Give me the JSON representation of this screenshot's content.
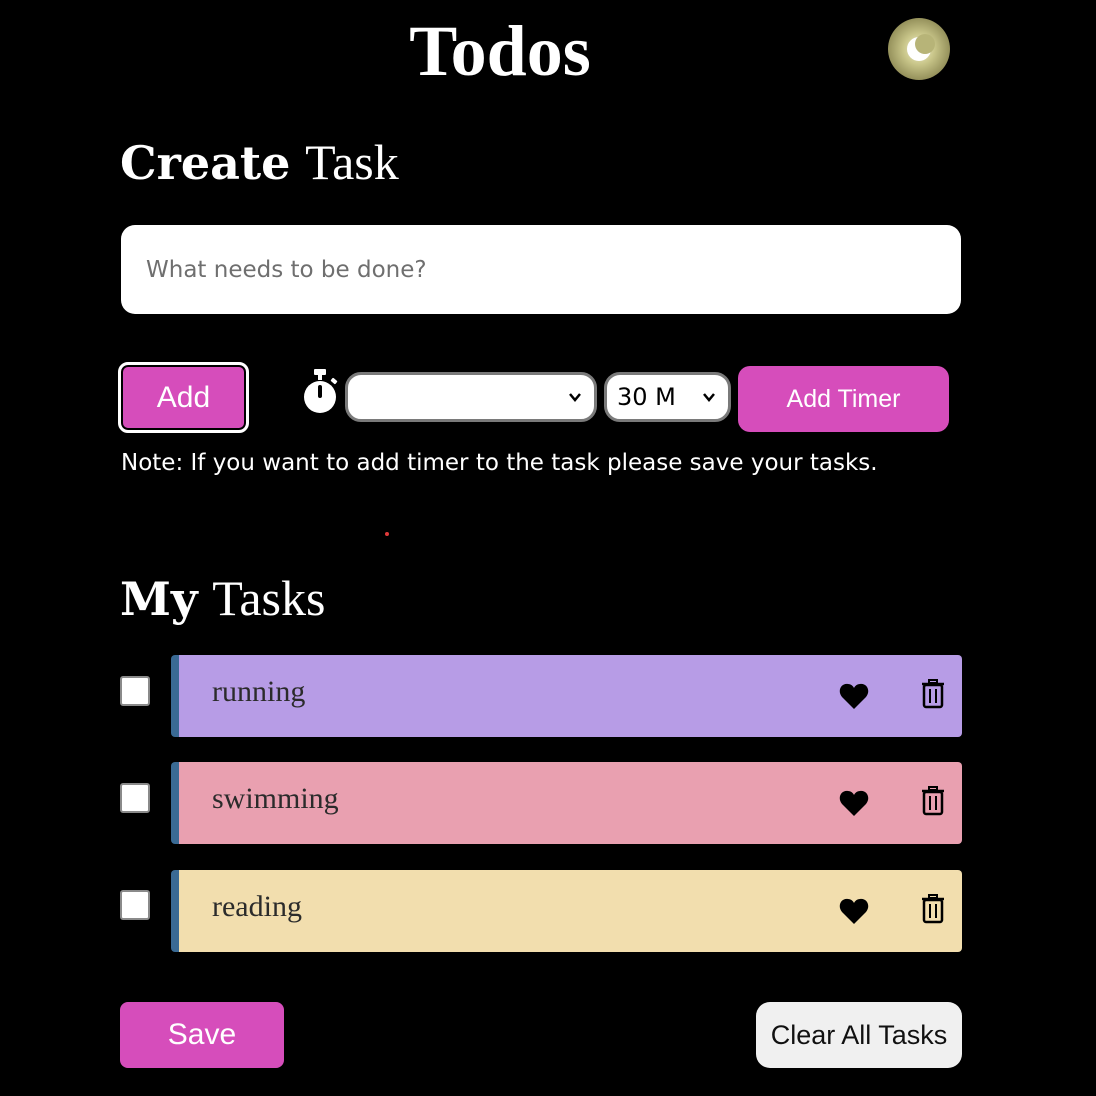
{
  "header": {
    "title": "Todos",
    "theme_toggle_icon": "moon-icon"
  },
  "create_section": {
    "title_bold": "Create",
    "title_light": "Task",
    "input_placeholder": "What needs to be done?",
    "input_value": "",
    "add_label": "Add",
    "timer_icon": "stopwatch-icon",
    "task_select_value": "",
    "duration_select_value": "30 M",
    "add_timer_label": "Add Timer",
    "note": "Note: If you want to add timer to the task please save your tasks."
  },
  "tasks_section": {
    "title_bold": "My",
    "title_light": "Tasks",
    "tasks": [
      {
        "label": "running",
        "color": "#b79ce6",
        "checked": false
      },
      {
        "label": "swimming",
        "color": "#e9a0b0",
        "checked": false
      },
      {
        "label": "reading",
        "color": "#f2deae",
        "checked": false
      }
    ]
  },
  "footer": {
    "save_label": "Save",
    "clear_label": "Clear All Tasks"
  },
  "colors": {
    "accent": "#d64dbb",
    "background": "#000000",
    "card_border": "#3a6a94"
  }
}
